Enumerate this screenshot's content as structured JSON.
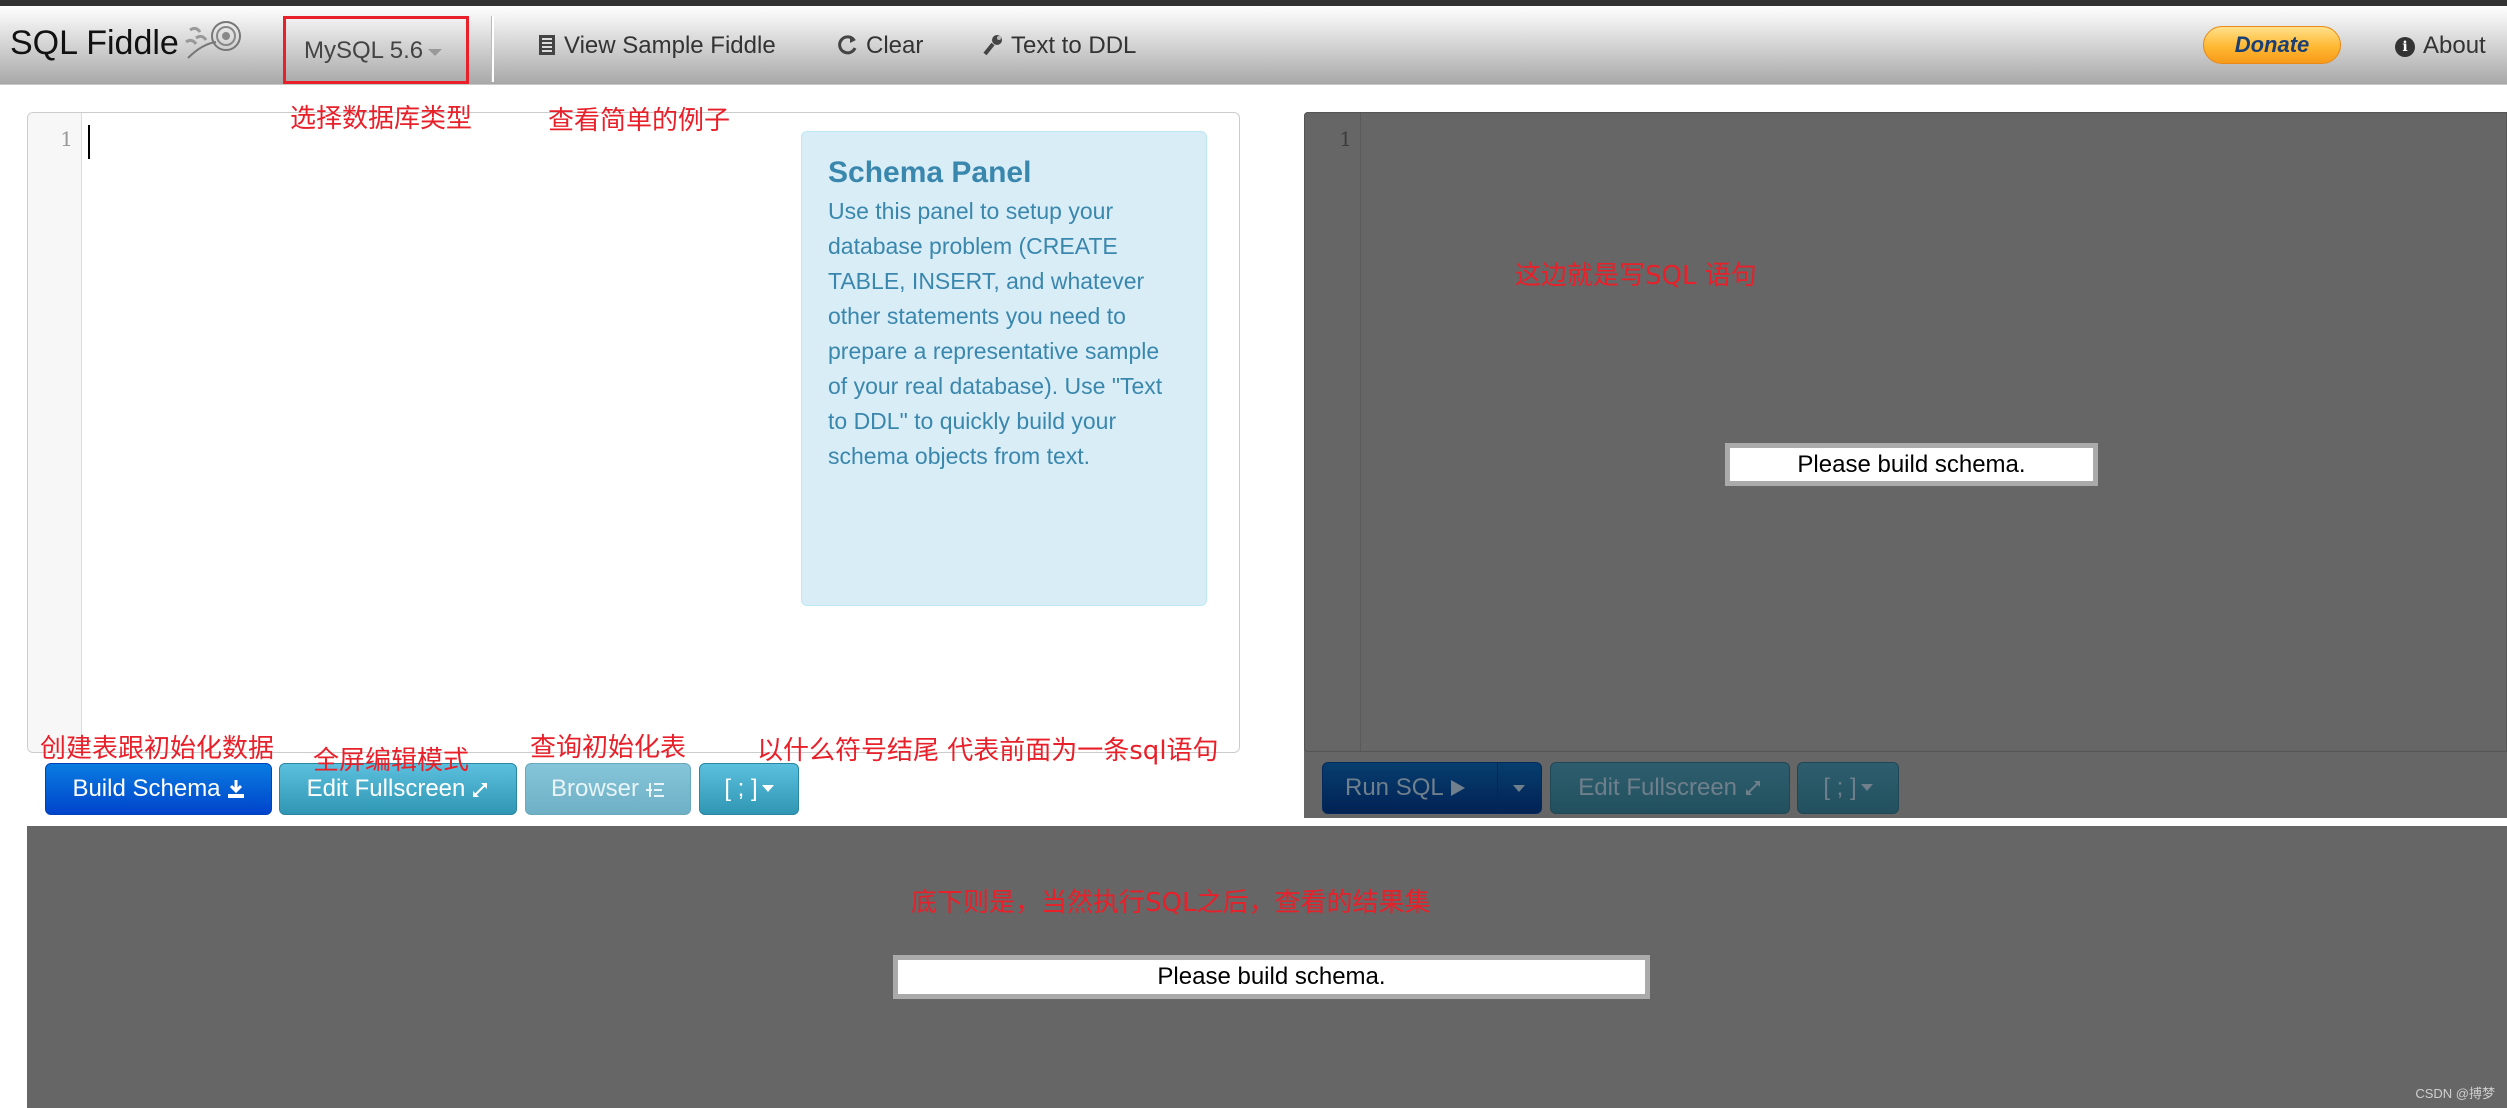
{
  "navbar": {
    "brand": "SQL Fiddle",
    "db_select": {
      "selected": "MySQL 5.6"
    },
    "items": [
      {
        "label": "View Sample Fiddle",
        "icon": "list-icon"
      },
      {
        "label": "Clear",
        "icon": "refresh-icon"
      },
      {
        "label": "Text to DDL",
        "icon": "wrench-icon"
      }
    ],
    "donate_label": "Donate",
    "about_label": "About"
  },
  "annotations": {
    "db_type": "选择数据库类型",
    "sample": "查看简单的例子",
    "build": "创建表跟初始化数据",
    "fullscreen": "全屏编辑模式",
    "browser": "查询初始化表",
    "terminator": "以什么符号结尾 代表前面为一条sql语句",
    "sql_editor": "这边就是写SQL 语句",
    "results": "底下则是，当然执行SQL之后，查看的结果集"
  },
  "schema_panel": {
    "line_number": "1",
    "help_title": "Schema Panel",
    "help_text": "Use this panel to setup your database problem (CREATE TABLE, INSERT, and whatever other statements you need to prepare a representative sample of your real database). Use \"Text to DDL\" to quickly build your schema objects from text.",
    "buttons": {
      "build": "Build Schema",
      "edit_fullscreen": "Edit Fullscreen",
      "browser": "Browser",
      "terminator": "[ ; ]"
    }
  },
  "sql_panel": {
    "line_number": "1",
    "message": "Please build schema.",
    "buttons": {
      "run": "Run SQL",
      "edit_fullscreen": "Edit Fullscreen",
      "terminator": "[ ; ]"
    }
  },
  "results_panel": {
    "message": "Please build schema."
  },
  "watermark": "CSDN @搏梦",
  "colors": {
    "annotation": "#e8202a",
    "build_button": "#0044cc",
    "info_button": "#2f96b4",
    "help_text": "#3a87ad",
    "overlay": "#666666"
  }
}
